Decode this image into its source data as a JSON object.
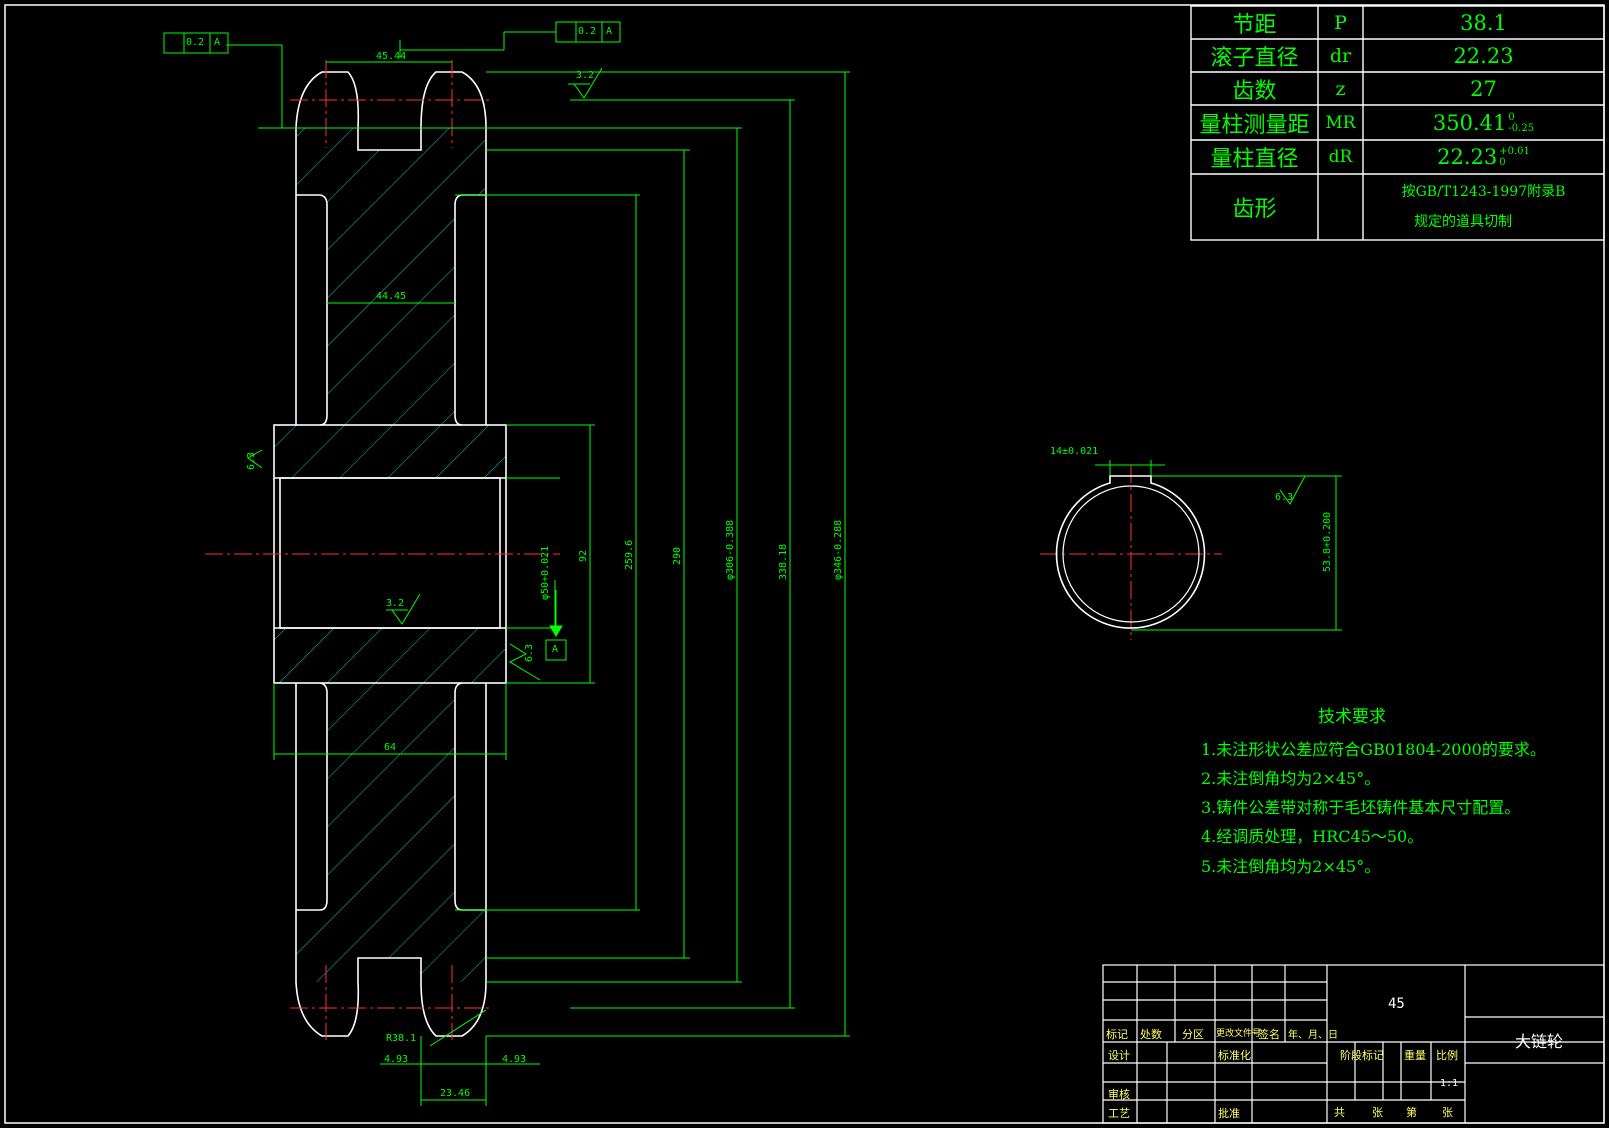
{
  "params_table": {
    "rows": [
      {
        "name": "节距",
        "symbol": "P",
        "value": "38.1"
      },
      {
        "name": "滚子直径",
        "symbol": "dr",
        "value": "22.23"
      },
      {
        "name": "齿数",
        "symbol": "z",
        "value": "27"
      },
      {
        "name": "量柱测量距",
        "symbol": "MR",
        "value": "350.41",
        "tol_upper": "0",
        "tol_lower": "-0.25"
      },
      {
        "name": "量柱直径",
        "symbol": "dR",
        "value": "22.23",
        "tol_upper": "+0.01",
        "tol_lower": "0"
      },
      {
        "name": "齿形",
        "symbol": "",
        "value_line1": "按GB/T1243-1997附录B",
        "value_line2": "规定的道具切制"
      }
    ]
  },
  "tech_requirements": {
    "title": "技术要求",
    "items": [
      "1.未注形状公差应符合GB01804-2000的要求。",
      "2.未注倒角均为2×45°。",
      "3.铸件公差带对称于毛坯铸件基本尺寸配置。",
      "4.经调质处理，HRC45～50。",
      "5.未注倒角均为2×45°。"
    ]
  },
  "title_block": {
    "material": "45",
    "part_name": "大链轮",
    "headers": [
      "标记",
      "处数",
      "分区",
      "更改文件号",
      "签名",
      "年、月、日"
    ],
    "row_design": "设计",
    "row_standard": "标准化",
    "row_review": "审核",
    "row_process": "工艺",
    "row_approve": "批准",
    "stage_label": "阶段标记",
    "weight_label": "重量",
    "scale_label": "比例",
    "scale_value": "1:1",
    "sheet_total": "共",
    "sheet_unit1": "张",
    "sheet_no": "第",
    "sheet_unit2": "张"
  },
  "dimensions": {
    "tooth_pitch": "45.44",
    "hub_width_inner": "44.45",
    "hub_total": "64",
    "tooth_width": "23.46",
    "chamfer_left": "4.93",
    "chamfer_right": "4.93",
    "radius": "R38.1",
    "roughness_top": "3.2",
    "roughness_bore": "3.2",
    "roughness_side1": "6.3",
    "roughness_side2": "6.3",
    "roughness_key": "6.3",
    "bore_dia": "φ50+0.021",
    "hub_dia": "92",
    "d1": "259.6",
    "d2": "290",
    "d3": "φ306-0.388",
    "d4": "338.18",
    "d5": "φ346-0.288",
    "key_width": "14±0.021",
    "key_depth": "53.8+0.200",
    "runout_tol": "0.2",
    "datum": "A"
  }
}
